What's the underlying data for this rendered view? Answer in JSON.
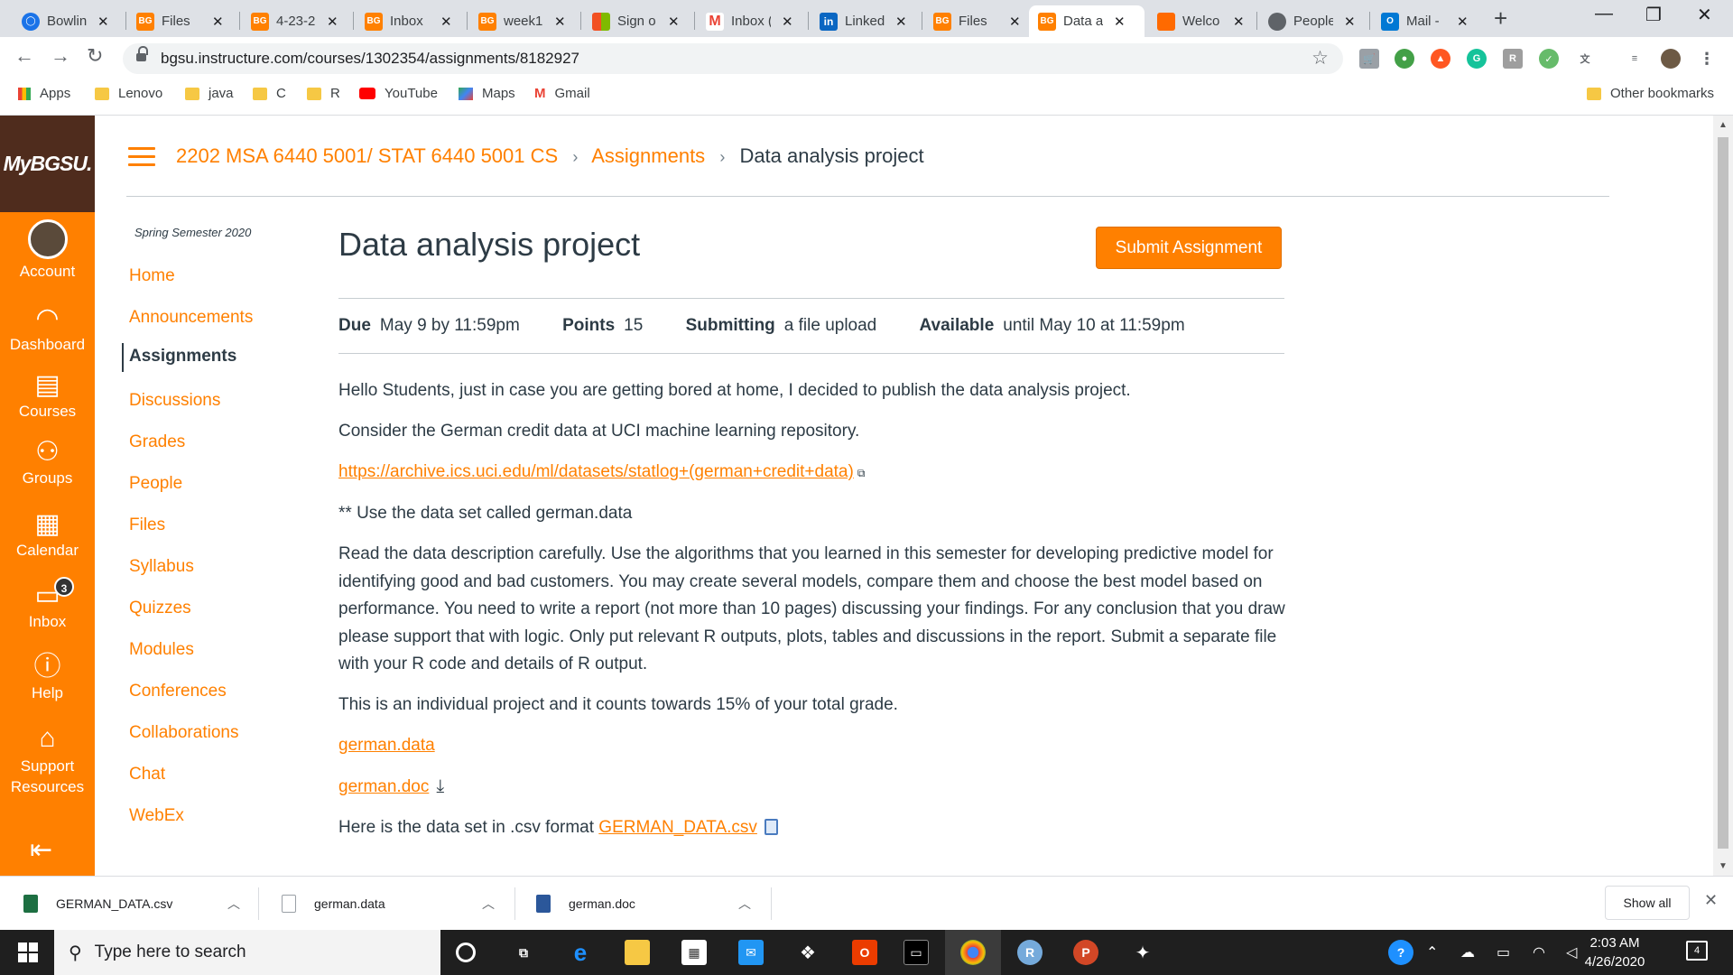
{
  "browser": {
    "tabs": [
      {
        "label": "Bowlin",
        "icon": "globe",
        "color": "#1a73e8"
      },
      {
        "label": "Files",
        "icon": "bgsu",
        "color": "#ff8000"
      },
      {
        "label": "4-23-2",
        "icon": "bgsu",
        "color": "#ff8000"
      },
      {
        "label": "Inbox",
        "icon": "bgsu",
        "color": "#ff8000"
      },
      {
        "label": "week1",
        "icon": "bgsu",
        "color": "#ff8000"
      },
      {
        "label": "Sign o",
        "icon": "microsoft",
        "color": "#f25022"
      },
      {
        "label": "Inbox (",
        "icon": "gmail",
        "color": "#ea4335"
      },
      {
        "label": "Linked",
        "icon": "linkedin",
        "color": "#0a66c2"
      },
      {
        "label": "Files",
        "icon": "bgsu",
        "color": "#ff8000"
      },
      {
        "label": "Data a",
        "icon": "bgsu",
        "color": "#ff8000"
      },
      {
        "label": "Welco",
        "icon": "orange-square",
        "color": "#ff6a00"
      },
      {
        "label": "People",
        "icon": "globe",
        "color": "#5f6368"
      },
      {
        "label": "Mail -",
        "icon": "outlook",
        "color": "#0078d4"
      }
    ],
    "active_tab_index": 9,
    "new_tab_label": "+",
    "window_controls": [
      "—",
      "❐",
      "✕"
    ],
    "url": "bgsu.instructure.com/courses/1302354/assignments/8182927",
    "bookmarks": [
      {
        "label": "Apps",
        "icon": "apps-grid"
      },
      {
        "label": "Lenovo",
        "icon": "folder"
      },
      {
        "label": "java",
        "icon": "folder"
      },
      {
        "label": "C",
        "icon": "folder"
      },
      {
        "label": "R",
        "icon": "folder"
      },
      {
        "label": "YouTube",
        "icon": "youtube"
      },
      {
        "label": "Maps",
        "icon": "maps"
      },
      {
        "label": "Gmail",
        "icon": "gmail"
      }
    ],
    "other_bookmarks": "Other bookmarks"
  },
  "global_nav": {
    "logo": "MyBGSU.",
    "items": [
      {
        "label": "Account",
        "icon": "avatar"
      },
      {
        "label": "Dashboard",
        "icon": "dashboard-icon"
      },
      {
        "label": "Courses",
        "icon": "courses-icon"
      },
      {
        "label": "Groups",
        "icon": "groups-icon"
      },
      {
        "label": "Calendar",
        "icon": "calendar-icon"
      },
      {
        "label": "Inbox",
        "icon": "inbox-icon",
        "badge": "3"
      },
      {
        "label": "Help",
        "icon": "help-icon"
      },
      {
        "label": "Support Resources",
        "icon": "home-icon"
      }
    ]
  },
  "breadcrumb": {
    "course": "2202 MSA 6440 5001/ STAT 6440 5001 CS",
    "section": "Assignments",
    "current": "Data analysis project"
  },
  "course_nav": {
    "term": "Spring Semester 2020",
    "items": [
      "Home",
      "Announcements",
      "Assignments",
      "Discussions",
      "Grades",
      "People",
      "Files",
      "Syllabus",
      "Quizzes",
      "Modules",
      "Conferences",
      "Collaborations",
      "Chat",
      "WebEx"
    ],
    "active": "Assignments"
  },
  "assignment": {
    "title": "Data analysis project",
    "submit_label": "Submit Assignment",
    "due_label": "Due",
    "due_value": "May 9 by 11:59pm",
    "points_label": "Points",
    "points_value": "15",
    "submitting_label": "Submitting",
    "submitting_value": "a file upload",
    "available_label": "Available",
    "available_value": "until May 10 at 11:59pm",
    "p1": "Hello Students, just in case you are getting bored at home, I decided to publish the data analysis project.",
    "p2": "Consider the German credit data at UCI machine learning repository.",
    "link_uci": "https://archive.ics.uci.edu/ml/datasets/statlog+(german+credit+data)",
    "p3": "** Use the data set called german.data",
    "p4": "Read the data description carefully. Use the algorithms that you learned in this semester for developing predictive model for identifying good and bad customers. You may create several models, compare them and choose the best model based on performance. You need to write a report (not more than 10 pages) discussing your findings. For any conclusion that you draw please support that with logic. Only put relevant R outputs, plots, tables and discussions in the report. Submit a separate file with your R code and details of R output.",
    "p5": "This is an individual project and it counts towards 15% of your total grade.",
    "file1": "german.data",
    "file2": "german.doc",
    "p6_prefix": "Here is the data set in .csv format ",
    "file3": "GERMAN_DATA.csv"
  },
  "downloads": {
    "items": [
      {
        "name": "GERMAN_DATA.csv",
        "icon": "excel-file-icon"
      },
      {
        "name": "german.data",
        "icon": "file-icon"
      },
      {
        "name": "german.doc",
        "icon": "word-file-icon"
      }
    ],
    "show_all": "Show all"
  },
  "taskbar": {
    "search_placeholder": "Type here to search",
    "time": "2:03 AM",
    "date": "4/26/2020",
    "notifications": "4"
  }
}
